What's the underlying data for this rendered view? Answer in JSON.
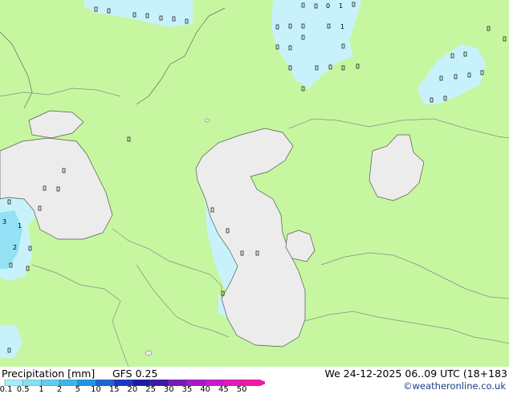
{
  "footer": {
    "title": "Precipitation [mm]",
    "model": "GFS 0.25",
    "datetime": "We 24-12-2025 06..09 UTC (18+183",
    "credit": "©weatheronline.co.uk"
  },
  "legend": {
    "labels": [
      "0.1",
      "0.5",
      "1",
      "2",
      "5",
      "10",
      "15",
      "20",
      "25",
      "30",
      "35",
      "40",
      "45",
      "50"
    ],
    "colors": [
      "#a3eef8",
      "#82e1f4",
      "#5fcdef",
      "#3cb5ea",
      "#1f95e2",
      "#1d63d8",
      "#1b38c8",
      "#1a1aa8",
      "#3e18a8",
      "#7a18b8",
      "#a718c8",
      "#cc18cc",
      "#e418c0",
      "#f218a6"
    ]
  },
  "colors": {
    "land": "#c6f7a0",
    "sea": "#ececec",
    "precip_light": "#c8f2fb",
    "precip_med": "#94e0f4",
    "border": "#8a8a8a",
    "coast": "#555555"
  },
  "map_values": [
    {
      "id": "v1",
      "text": "0"
    },
    {
      "id": "v2",
      "text": "1"
    },
    {
      "id": "v3",
      "text": "2"
    },
    {
      "id": "v4",
      "text": "3"
    },
    {
      "id": "v5",
      "text": "1"
    },
    {
      "id": "v6",
      "text": "1"
    }
  ]
}
